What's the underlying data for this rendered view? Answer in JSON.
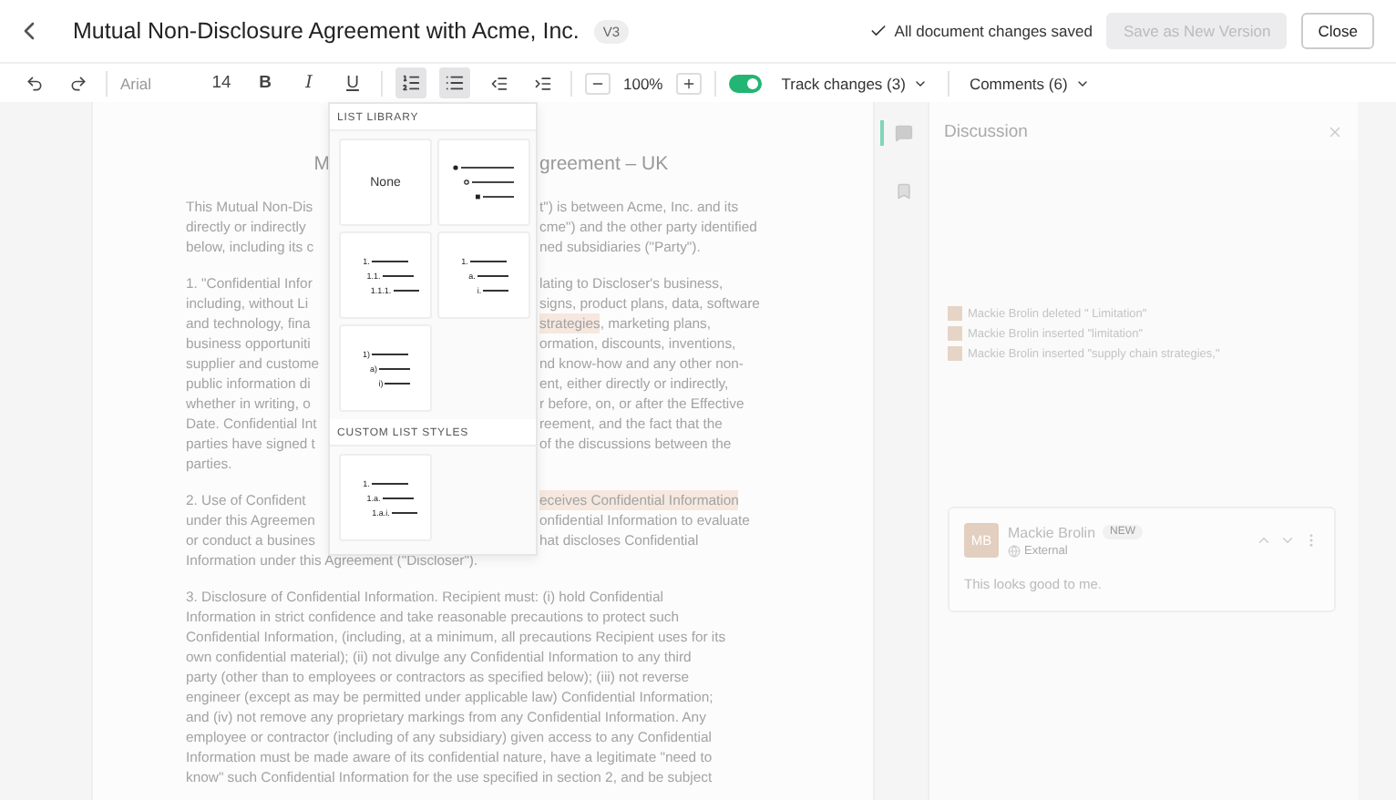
{
  "header": {
    "title": "Mutual Non-Disclosure Agreement with Acme, Inc.",
    "version": "V3",
    "save_status": "All document changes saved",
    "buttons": [
      {
        "label": "Save as New Version",
        "disabled": true
      },
      {
        "label": "Close",
        "disabled": false
      }
    ]
  },
  "toolbar": {
    "font": "Arial",
    "size": "14",
    "format_buttons": [
      {
        "kind": "bold",
        "label": "B"
      },
      {
        "kind": "italic",
        "label": "I"
      },
      {
        "kind": "underline",
        "label": "U"
      }
    ],
    "lists": [
      {
        "kind": "numbered",
        "selected": true
      },
      {
        "kind": "bullet",
        "selected": true
      }
    ],
    "zoom": "100%",
    "track_changes": {
      "on": true,
      "label": "Track changes (3)"
    },
    "comments": "Comments (6)"
  },
  "list_menu": {
    "sections": [
      {
        "title": "LIST LIBRARY",
        "styles": [
          {
            "kind": "none",
            "label": "None"
          },
          {
            "kind": "bullets"
          },
          {
            "kind": "numbered",
            "markers": [
              "1.",
              "1.1.",
              "1.1.1."
            ]
          },
          {
            "kind": "numbered",
            "markers": [
              "1.",
              "a.",
              "i."
            ]
          },
          {
            "kind": "numbered",
            "markers": [
              "1)",
              "a)",
              "i)"
            ]
          }
        ]
      },
      {
        "title": "CUSTOM LIST STYLES",
        "styles": [
          {
            "kind": "numbered",
            "markers": [
              "1.",
              "1.a.",
              "1.a.i."
            ]
          }
        ]
      }
    ]
  },
  "document": {
    "title": {
      "left": "M",
      "right": "greement – UK"
    },
    "paragraphs": [
      {
        "lines": [
          {
            "left": "This Mutual Non-Dis",
            "right": [
              {
                "text": "t\") is between Acme, Inc. and its",
                "highlight": false
              }
            ]
          },
          {
            "left": "directly or indirectly",
            "right": [
              {
                "text": "cme\") and the other party identified",
                "highlight": false
              }
            ]
          },
          {
            "left": "below, including its c",
            "right": [
              {
                "text": "ned subsidiaries (\"Party\").",
                "highlight": false
              }
            ]
          }
        ]
      },
      {
        "lines": [
          {
            "left": "1.  \"Confidential Infor",
            "right": [
              {
                "text": "lating to Discloser's business,",
                "highlight": false
              }
            ]
          },
          {
            "left": "including, without Li",
            "right": [
              {
                "text": "signs, product plans, data, software",
                "highlight": false
              }
            ]
          },
          {
            "left": "and technology, fina",
            "right": [
              {
                "text": "strategies",
                "highlight": true
              },
              {
                "text": ", marketing plans,",
                "highlight": false
              }
            ]
          },
          {
            "left": "business opportuniti",
            "right": [
              {
                "text": "ormation, discounts, inventions,",
                "highlight": false
              }
            ]
          },
          {
            "left": "supplier and custome",
            "right": [
              {
                "text": "nd know-how and any other non-",
                "highlight": false
              }
            ]
          },
          {
            "left": "public information di",
            "right": [
              {
                "text": "ent, either directly or indirectly,",
                "highlight": false
              }
            ]
          },
          {
            "left": "whether in writing, o",
            "right": [
              {
                "text": "r before, on, or after the Effective",
                "highlight": false
              }
            ]
          },
          {
            "left": "Date. Confidential Int",
            "right": [
              {
                "text": "reement, and the fact that the",
                "highlight": false
              }
            ]
          },
          {
            "left": "parties have signed t",
            "right": [
              {
                "text": "of the discussions between the",
                "highlight": false
              }
            ]
          },
          {
            "left": "parties."
          }
        ]
      },
      {
        "lines": [
          {
            "left": "2.  Use of Confident",
            "right": [
              {
                "text": "eceives Confidential Information",
                "highlight": true
              }
            ]
          },
          {
            "left": "under this Agreemen",
            "right": [
              {
                "text": "onfidential Information to evaluate",
                "highlight": false
              }
            ]
          },
          {
            "left": "or conduct a busines",
            "right": [
              {
                "text": "hat discloses Confidential",
                "highlight": false
              }
            ]
          },
          {
            "text": "Information under this Agreement (\"Discloser\")."
          }
        ]
      },
      {
        "lines": [
          {
            "text": "3. Disclosure of Confidential Information. Recipient must: (i) hold Confidential"
          },
          {
            "text": "Information in strict confidence and take reasonable precautions to protect such"
          },
          {
            "text": "Confidential Information, (including, at a minimum, all precautions Recipient uses for its"
          },
          {
            "text": "own confidential material); (ii) not divulge any Confidential Information to any third"
          },
          {
            "text": "party (other than to employees or contractors as specified below); (iii) not reverse"
          },
          {
            "text": "engineer (except as may be permitted under applicable law)  Confidential Information;"
          },
          {
            "text": "and (iv) not remove any proprietary markings from any Confidential Information. Any"
          },
          {
            "text": "employee or contractor (including of any subsidiary) given access to any Confidential"
          },
          {
            "text": "Information must be made aware of its confidential nature, have a legitimate \"need to"
          },
          {
            "text": "know\" such Confidential Information for the use specified in section 2, and be subject"
          }
        ]
      }
    ]
  },
  "rail": [
    {
      "kind": "comments",
      "selected": true
    },
    {
      "kind": "bookmark",
      "selected": false
    }
  ],
  "discussion": {
    "title": "Discussion",
    "changes": [
      "Mackie Brolin deleted \" Limitation\"",
      "Mackie Brolin inserted \"limitation\"",
      "Mackie Brolin inserted \"supply chain strategies,\""
    ],
    "comment": {
      "initials": "MB",
      "author": "Mackie Brolin",
      "badge": "NEW",
      "audience": "External",
      "text": "This looks good to me."
    }
  }
}
